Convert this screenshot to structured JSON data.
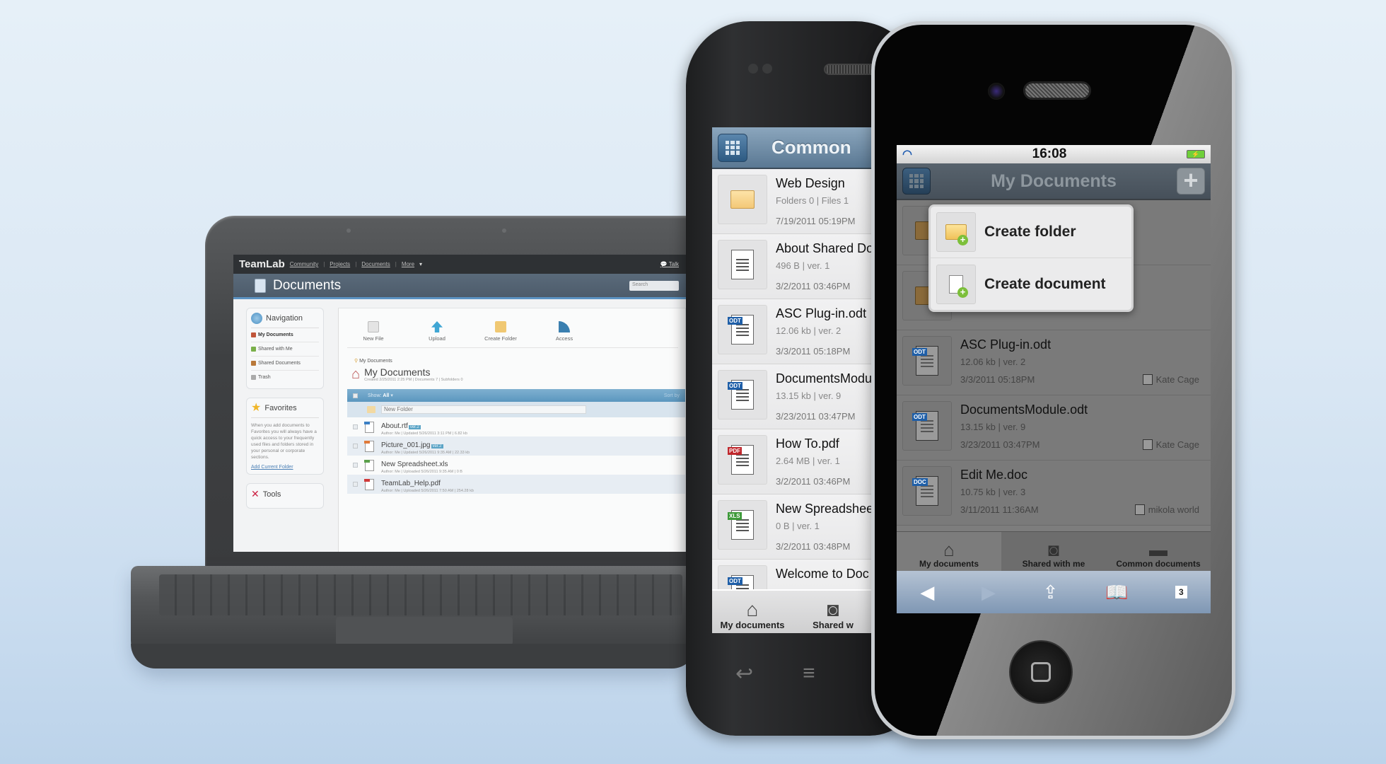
{
  "laptop": {
    "logo": "TeamLab",
    "top_links": [
      "Community",
      "Projects",
      "Documents",
      "More"
    ],
    "talk": "Talk",
    "header_title": "Documents",
    "search_placeholder": "Search",
    "navigation": {
      "title": "Navigation",
      "items": [
        {
          "label": "My Documents",
          "active": true
        },
        {
          "label": "Shared with Me",
          "active": false
        },
        {
          "label": "Shared Documents",
          "active": false
        },
        {
          "label": "Trash",
          "active": false
        }
      ]
    },
    "favorites": {
      "title": "Favorites",
      "text": "When you add documents to Favorites you will always have a quick access to your frequently used files and folders stored in your personal or corporate sections.",
      "link": "Add Current Folder"
    },
    "tools_title": "Tools",
    "toolbar": [
      "New File",
      "Upload",
      "Create Folder",
      "Access"
    ],
    "breadcrumb": "My Documents",
    "folder_title": "My Documents",
    "folder_meta": "Created 2/25/2011 2:25 PM | Documents 7 | Subfolders 0",
    "list_header": {
      "show_label": "Show:",
      "show_value": "All",
      "sort_label": "Sort by"
    },
    "new_folder_value": "New Folder",
    "files": [
      {
        "name": "About.rtf",
        "version": "ver.2",
        "meta": "Author: Me | Updated 5/26/2011 3:11 PM | 6.82 kb",
        "tag_color": "#3b7fc4"
      },
      {
        "name": "Picture_001.jpg",
        "version": "ver.2",
        "meta": "Author: Me | Updated 5/26/2011 9:35 AM | 22.33 kb",
        "tag_color": "#e07a3a"
      },
      {
        "name": "New Spreadsheet.xls",
        "version": "",
        "meta": "Author: Me | Uploaded 5/26/2011 9:35 AM | 0 B",
        "tag_color": "#5aa04a"
      },
      {
        "name": "TeamLab_Help.pdf",
        "version": "",
        "meta": "Author: Me | Uploaded 5/26/2011 7:50 AM | 254.28 kb",
        "tag_color": "#d03a3a"
      }
    ]
  },
  "android": {
    "title": "Common",
    "items": [
      {
        "name": "Web Design",
        "meta": "Folders 0 | Files 1",
        "date": "7/19/2011 05:19PM",
        "type": "folder"
      },
      {
        "name": "About Shared Do",
        "meta": "496 B | ver. 1",
        "date": "3/2/2011 03:46PM",
        "type": "doc"
      },
      {
        "name": "ASC Plug-in.odt",
        "meta": "12.06 kb | ver. 2",
        "date": "3/3/2011 05:18PM",
        "type": "ODT"
      },
      {
        "name": "DocumentsModu",
        "meta": "13.15 kb | ver. 9",
        "date": "3/23/2011 03:47PM",
        "type": "ODT"
      },
      {
        "name": "How To.pdf",
        "meta": "2.64 MB | ver. 1",
        "date": "3/2/2011 03:46PM",
        "type": "PDF"
      },
      {
        "name": "New Spreadshee",
        "meta": "0 B | ver. 1",
        "date": "3/2/2011 03:48PM",
        "type": "XLS"
      },
      {
        "name": "Welcome to Doc",
        "meta": "",
        "date": "",
        "type": "ODT"
      }
    ],
    "tabs": [
      "My documents",
      "Shared w"
    ]
  },
  "iphone": {
    "time": "16:08",
    "title": "My Documents",
    "popup": [
      "Create folder",
      "Create document"
    ],
    "items": [
      {
        "name": "",
        "meta": "",
        "date": "",
        "owner": "",
        "type": "folder"
      },
      {
        "name": "",
        "meta": "",
        "date": "",
        "owner": "",
        "type": "folder"
      },
      {
        "name": "ASC Plug-in.odt",
        "meta": "12.06 kb | ver. 2",
        "date": "3/3/2011 05:18PM",
        "owner": "Kate Cage",
        "type": "ODT"
      },
      {
        "name": "DocumentsModule.odt",
        "meta": "13.15 kb | ver. 9",
        "date": "3/23/2011 03:47PM",
        "owner": "Kate Cage",
        "type": "ODT"
      },
      {
        "name": "Edit Me.doc",
        "meta": "10.75 kb | ver. 3",
        "date": "3/11/2011 11:36AM",
        "owner": "mikola world",
        "type": "DOC"
      }
    ],
    "tabs": [
      "My documents",
      "Shared with me",
      "Common documents"
    ],
    "safari_tab_count": "3"
  },
  "colors": {
    "odt": "#1f5fa8",
    "pdf": "#c0282d",
    "xls": "#3e9a3a",
    "doc": "#1f5fa8",
    "accent_blue": "#5b97bf"
  }
}
